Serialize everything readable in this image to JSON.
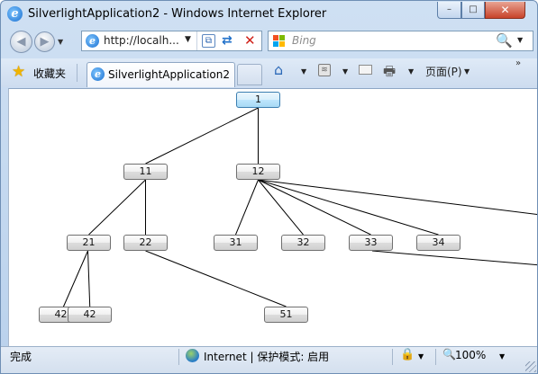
{
  "window": {
    "title": "SilverlightApplication2 - Windows Internet Explorer",
    "min_glyph": "–",
    "max_glyph": "□",
    "close_glyph": "✕"
  },
  "nav": {
    "back_glyph": "◀",
    "forward_glyph": "▶",
    "dropdown_glyph": "▼",
    "address": "http://localh...",
    "address_dropdown_glyph": "▼",
    "compat_glyph": "⧉",
    "refresh_glyph": "⇄",
    "stop_glyph": "✕"
  },
  "search": {
    "placeholder": "Bing",
    "search_glyph": "🔍",
    "dropdown_glyph": "▼",
    "logo_colors": [
      "#f25022",
      "#7fba00",
      "#00a4ef",
      "#ffb900"
    ]
  },
  "tabbar": {
    "favorites_label": "收藏夹",
    "favorites_glyph": "★",
    "tab_label": "SilverlightApplication2",
    "home_glyph": "⌂",
    "home_dropdown": "▼",
    "feeds_glyph": "≋",
    "feeds_dropdown": "▼",
    "print_glyph": "🖶",
    "print_dropdown": "▼",
    "page_menu_label": "页面(P)",
    "page_menu_dropdown": "▼",
    "more_glyph": "»"
  },
  "tree": {
    "nodes": [
      {
        "id": "n1",
        "label": "1",
        "selected": true
      },
      {
        "id": "n11",
        "label": "11"
      },
      {
        "id": "n12",
        "label": "12"
      },
      {
        "id": "n21",
        "label": "21"
      },
      {
        "id": "n22",
        "label": "22"
      },
      {
        "id": "n31",
        "label": "31"
      },
      {
        "id": "n32",
        "label": "32"
      },
      {
        "id": "n33",
        "label": "33"
      },
      {
        "id": "n34",
        "label": "34"
      },
      {
        "id": "n42a",
        "label": "42"
      },
      {
        "id": "n42b",
        "label": "42"
      },
      {
        "id": "n51",
        "label": "51"
      }
    ],
    "edges": [
      [
        "n1",
        "n11"
      ],
      [
        "n1",
        "n12"
      ],
      [
        "n11",
        "n21"
      ],
      [
        "n11",
        "n22"
      ],
      [
        "n12",
        "n31"
      ],
      [
        "n12",
        "n32"
      ],
      [
        "n12",
        "n33"
      ],
      [
        "n12",
        "n34"
      ],
      [
        "n12",
        "offscreen"
      ],
      [
        "n33",
        "offscreen"
      ],
      [
        "n21",
        "n42a"
      ],
      [
        "n21",
        "n42b"
      ],
      [
        "n22",
        "n51"
      ]
    ]
  },
  "status": {
    "text": "完成",
    "zone_label": "Internet",
    "zone_separator": " | ",
    "protected_mode": "保护模式: 启用",
    "security_glyph": "🔒",
    "security_dropdown": "▼",
    "zoom_glyph": "🔍",
    "zoom_level": "100%",
    "zoom_dropdown": "▼"
  },
  "colors": {
    "chrome_blue": "#b9d1ec",
    "close_red": "#c8422a",
    "edge_color": "#000000",
    "node_selected_border": "#3c7fb1"
  }
}
